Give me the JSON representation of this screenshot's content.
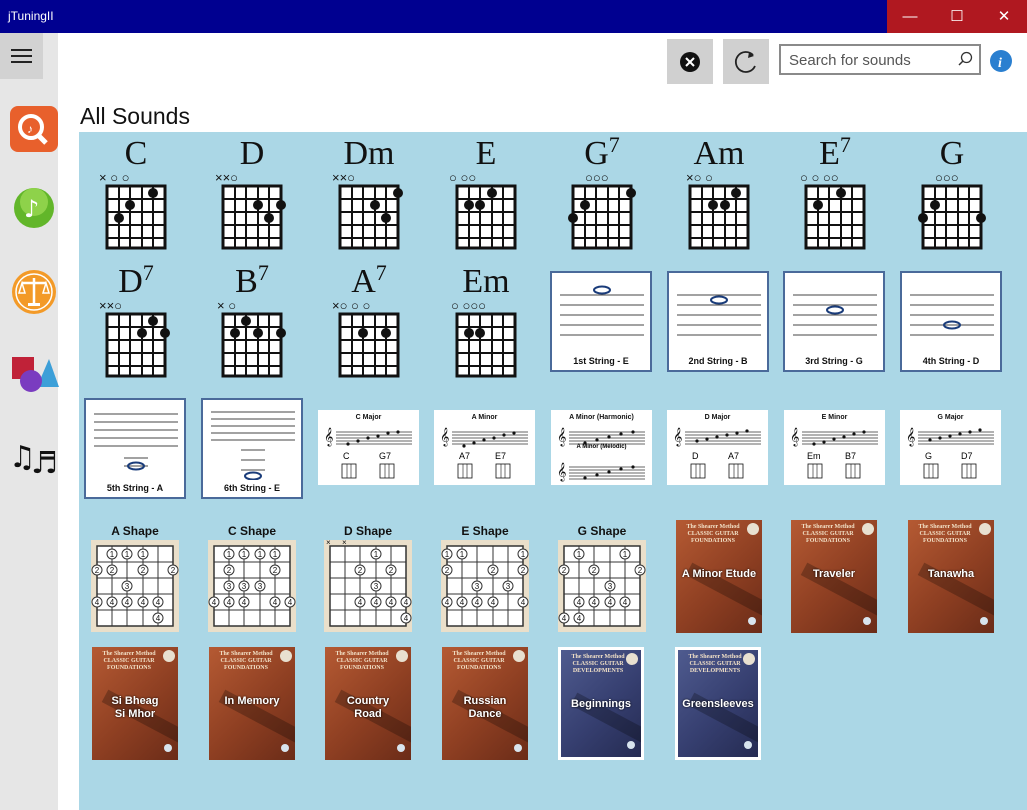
{
  "window": {
    "title": "jTuningII",
    "controls": {
      "minimize": "—",
      "maximize": "☐",
      "close": "✕"
    }
  },
  "nav": {
    "items": [
      {
        "name": "quiz",
        "icon": "quiz-icon"
      },
      {
        "name": "music-note",
        "icon": "music-note-icon"
      },
      {
        "name": "balance",
        "icon": "balance-scale-icon"
      },
      {
        "name": "shapes",
        "icon": "shapes-icon"
      },
      {
        "name": "notes",
        "icon": "music-notes-icon"
      }
    ]
  },
  "search": {
    "placeholder": "Search for sounds",
    "value": ""
  },
  "page": {
    "heading": "All Sounds"
  },
  "chords": [
    {
      "name": "C",
      "sup": "",
      "marks": "×   ○ ○"
    },
    {
      "name": "D",
      "sup": "",
      "marks": "××○"
    },
    {
      "name": "Dm",
      "sup": "",
      "marks": "××○"
    },
    {
      "name": "E",
      "sup": "",
      "marks": "○   ○○"
    },
    {
      "name": "G",
      "sup": "7",
      "marks": "○○○"
    },
    {
      "name": "Am",
      "sup": "",
      "marks": "×○       ○"
    },
    {
      "name": "E",
      "sup": "7",
      "marks": "○  ○  ○○"
    },
    {
      "name": "G",
      "sup": "",
      "marks": "○○○"
    },
    {
      "name": "D",
      "sup": "7",
      "marks": "××○"
    },
    {
      "name": "B",
      "sup": "7",
      "marks": "×     ○"
    },
    {
      "name": "A",
      "sup": "7",
      "marks": "×○  ○  ○"
    },
    {
      "name": "Em",
      "sup": "",
      "marks": "○   ○○○"
    }
  ],
  "strings": [
    {
      "label": "1st String - E"
    },
    {
      "label": "2nd String - B"
    },
    {
      "label": "3rd String - G"
    },
    {
      "label": "4th String - D"
    },
    {
      "label": "5th String - A"
    },
    {
      "label": "6th String - E"
    }
  ],
  "scales": [
    {
      "title": "C Major",
      "chords": [
        "C",
        "G7"
      ]
    },
    {
      "title": "A Minor",
      "chords": [
        "A7",
        "E7"
      ]
    },
    {
      "title": "A Minor (Harmonic)",
      "subtitle": "A Minor (Melodic)",
      "chords": []
    },
    {
      "title": "D Major",
      "chords": [
        "D",
        "A7"
      ]
    },
    {
      "title": "E Minor",
      "chords": [
        "Em",
        "B7"
      ]
    },
    {
      "title": "G Major",
      "chords": [
        "G",
        "D7"
      ]
    }
  ],
  "shapes": [
    {
      "label": "A Shape"
    },
    {
      "label": "C Shape"
    },
    {
      "label": "D Shape"
    },
    {
      "label": "E Shape"
    },
    {
      "label": "G Shape"
    }
  ],
  "books": [
    {
      "header": "The Shearer Method CLASSIC GUITAR FOUNDATIONS",
      "title": "A Minor Etude",
      "style": "orange"
    },
    {
      "header": "The Shearer Method CLASSIC GUITAR FOUNDATIONS",
      "title": "Traveler",
      "style": "orange"
    },
    {
      "header": "The Shearer Method CLASSIC GUITAR FOUNDATIONS",
      "title": "Tanawha",
      "style": "orange"
    },
    {
      "header": "The Shearer Method CLASSIC GUITAR FOUNDATIONS",
      "title": "Si Bheag Si Mhor",
      "style": "orange"
    },
    {
      "header": "The Shearer Method CLASSIC GUITAR FOUNDATIONS",
      "title": "In Memory",
      "style": "orange"
    },
    {
      "header": "The Shearer Method CLASSIC GUITAR FOUNDATIONS",
      "title": "Country Road",
      "style": "orange"
    },
    {
      "header": "The Shearer Method CLASSIC GUITAR FOUNDATIONS",
      "title": "Russian Dance",
      "style": "orange"
    },
    {
      "header": "The Shearer Method CLASSIC GUITAR DEVELOPMENTS",
      "title": "Beginnings",
      "style": "blue"
    },
    {
      "header": "The Shearer Method CLASSIC GUITAR DEVELOPMENTS",
      "title": "Greensleeves",
      "style": "blue"
    }
  ],
  "colors": {
    "titlebar": "#000090",
    "content_bg": "#abd7e6",
    "close_bg": "#b01820"
  }
}
